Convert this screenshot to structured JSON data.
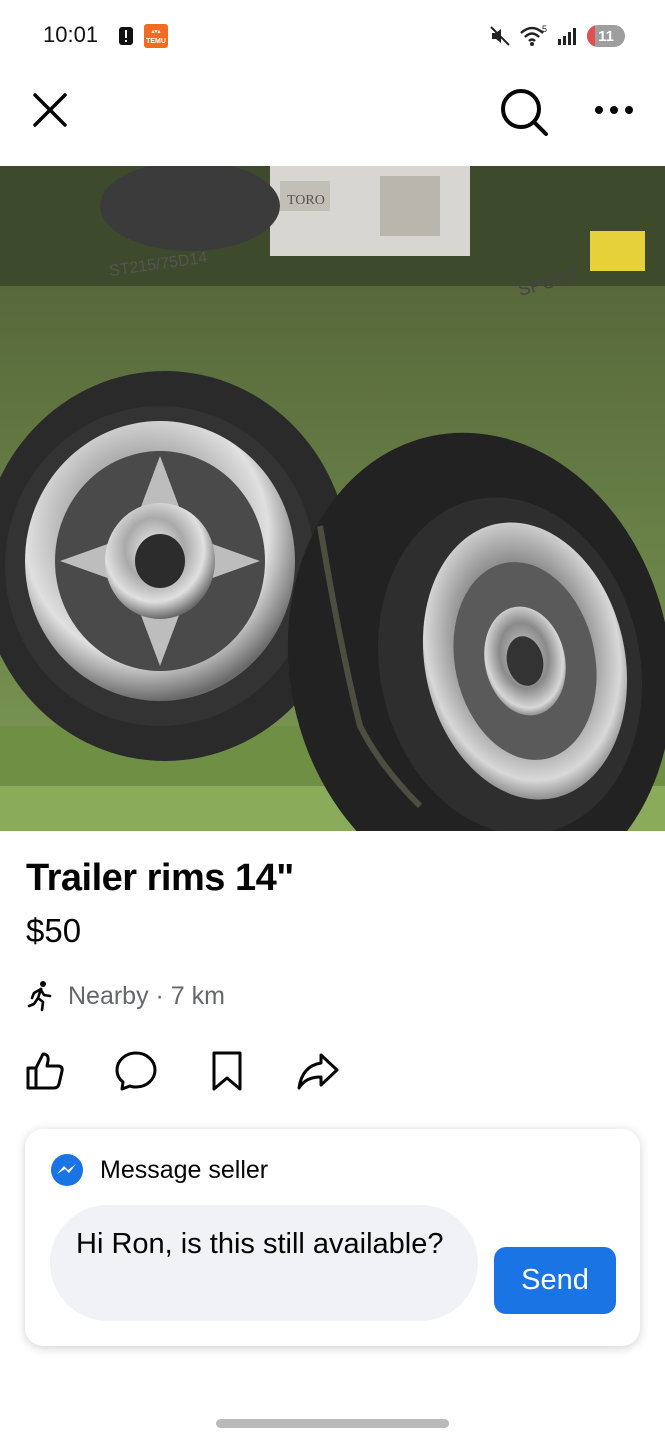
{
  "status_bar": {
    "time": "10:01",
    "temu_badge": "TEMU",
    "battery_level": "11",
    "wifi_label": "5"
  },
  "nav": {
    "close_icon": "close-icon",
    "search_icon": "search-icon",
    "more_icon": "more-dots-icon"
  },
  "listing": {
    "title": "Trailer rims 14\"",
    "price": "$50",
    "location": "Nearby · 7 km",
    "photo_subject": "Two chrome trailer rims with tires on grass"
  },
  "actions": [
    {
      "icon": "like-icon"
    },
    {
      "icon": "comment-icon"
    },
    {
      "icon": "save-icon"
    },
    {
      "icon": "share-icon"
    }
  ],
  "message": {
    "header": "Message seller",
    "input_value": "Hi Ron, is this still available?",
    "send_label": "Send"
  },
  "colors": {
    "accent": "#1b74e4",
    "secondary_text": "#65676b",
    "input_bg": "#f0f2f5"
  }
}
